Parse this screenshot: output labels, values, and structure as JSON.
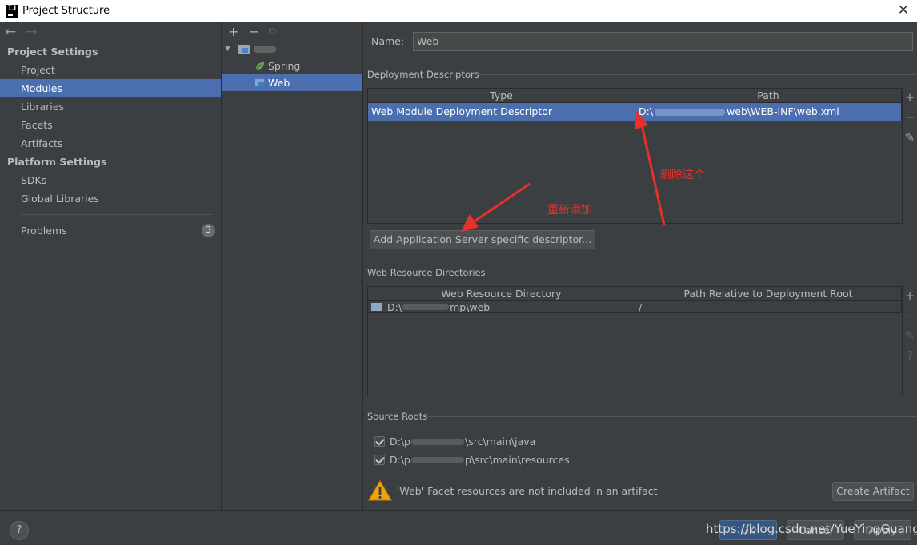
{
  "window": {
    "title": "Project Structure",
    "close_glyph": "✕"
  },
  "nav": {
    "back_glyph": "←",
    "forward_glyph": "→",
    "project_settings_title": "Project Settings",
    "project_items": [
      "Project",
      "Modules",
      "Libraries",
      "Facets",
      "Artifacts"
    ],
    "selected": "Modules",
    "platform_settings_title": "Platform Settings",
    "platform_items": [
      "SDKs",
      "Global Libraries"
    ],
    "problems_label": "Problems",
    "problems_count": "3"
  },
  "tree": {
    "toolbar": {
      "add": "+",
      "remove": "−",
      "copy": "⧉"
    },
    "root_expand_glyph": "▼",
    "items": [
      {
        "label": "Spring",
        "icon": "spring-leaf-icon"
      },
      {
        "label": "Web",
        "icon": "web-facet-icon",
        "selected": true
      }
    ]
  },
  "facet": {
    "name_label": "Name:",
    "name_value": "Web",
    "deployment_descriptors": {
      "title": "Deployment Descriptors",
      "columns": [
        "Type",
        "Path"
      ],
      "rows": [
        {
          "type": "Web Module Deployment Descriptor",
          "path_prefix": "D:\\",
          "path_suffix": "web\\WEB-INF\\web.xml"
        }
      ],
      "add_button": "Add Application Server specific descriptor..."
    },
    "web_resource_directories": {
      "title": "Web Resource Directories",
      "columns": [
        "Web Resource Directory",
        "Path Relative to Deployment Root"
      ],
      "rows": [
        {
          "directory_prefix": "D:\\",
          "directory_suffix": "mp\\web",
          "relative_path": "/"
        }
      ]
    },
    "source_roots": {
      "title": "Source Roots",
      "items": [
        {
          "prefix": "D:\\p",
          "suffix": "\\src\\main\\java",
          "checked": true
        },
        {
          "prefix": "D:\\p",
          "suffix": "p\\src\\main\\resources",
          "checked": true
        }
      ]
    },
    "warning_text": "'Web' Facet resources are not included in an artifact",
    "create_artifact_button": "Create Artifact",
    "side_tools": {
      "add": "+",
      "remove": "−",
      "edit": "✎",
      "help": "?"
    }
  },
  "annotations": {
    "delete_this": "删除这个",
    "re_add": "重新添加",
    "color": "#e8302b"
  },
  "bottom": {
    "help_glyph": "?",
    "ok_button": "OK",
    "cancel_button": "Cancel",
    "apply_button": "Apply",
    "watermark": "https://blog.csdn.net/YueYingGuang"
  }
}
